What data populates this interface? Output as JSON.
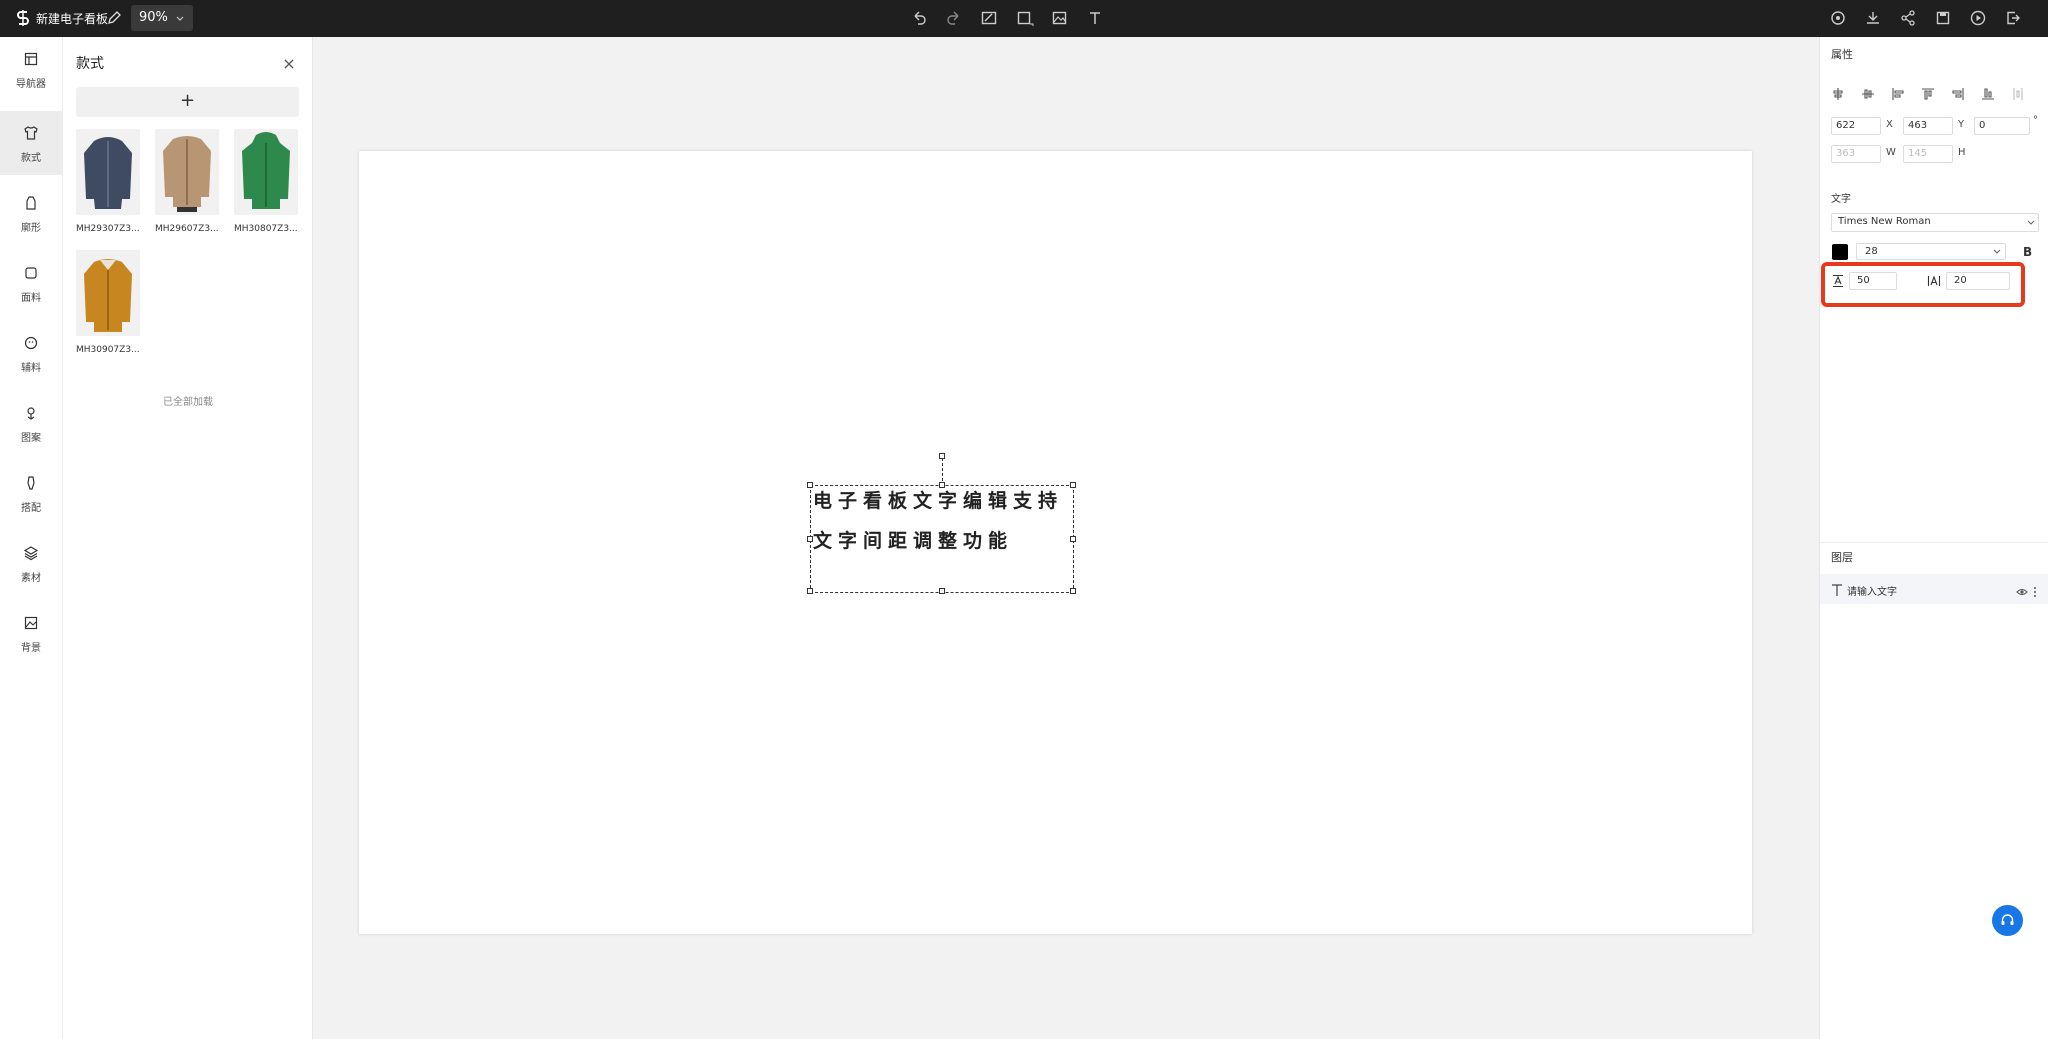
{
  "topbar": {
    "title": "新建电子看板",
    "zoom": "90%",
    "tools": [
      "undo-icon",
      "redo-icon",
      "image-edit-icon",
      "rectangle-icon",
      "picture-icon",
      "text-tool-icon"
    ],
    "actions": [
      "preview-icon",
      "download-icon",
      "share-icon",
      "save-icon",
      "play-icon",
      "exit-icon"
    ]
  },
  "rail": {
    "items": [
      {
        "label": "导航器",
        "icon": "navigator-icon"
      },
      {
        "label": "款式",
        "icon": "shirt-icon",
        "active": true
      },
      {
        "label": "廓形",
        "icon": "silhouette-icon"
      },
      {
        "label": "面料",
        "icon": "fabric-icon"
      },
      {
        "label": "辅料",
        "icon": "button-icon"
      },
      {
        "label": "图案",
        "icon": "pattern-icon"
      },
      {
        "label": "搭配",
        "icon": "outfit-icon"
      },
      {
        "label": "素材",
        "icon": "layers-icon"
      },
      {
        "label": "背景",
        "icon": "background-icon"
      }
    ]
  },
  "panel": {
    "title": "款式",
    "add_label": "+",
    "items": [
      {
        "caption": "MH29307Z3...",
        "color": "#3f4a63"
      },
      {
        "caption": "MH29607Z3...",
        "color": "#b89674"
      },
      {
        "caption": "MH30807Z3...",
        "color": "#2e8a4c"
      },
      {
        "caption": "MH30907Z3...",
        "color": "#c7861f"
      }
    ],
    "footer": "已全部加载"
  },
  "canvas": {
    "text_lines": [
      "电子看板文字编辑支持",
      "文字间距调整功能"
    ]
  },
  "props": {
    "title": "属性",
    "x": "622",
    "x_label": "X",
    "y": "463",
    "y_label": "Y",
    "rotation": "0",
    "rotation_unit": "°",
    "w": "363",
    "w_label": "W",
    "h": "145",
    "h_label": "H",
    "text_section": "文字",
    "font": "Times New Roman",
    "color": "#000000",
    "size": "28",
    "bold_label": "B",
    "line_height": "50",
    "letter_spacing": "20"
  },
  "layers": {
    "title": "图层",
    "items": [
      {
        "name": "请输入文字"
      }
    ]
  }
}
